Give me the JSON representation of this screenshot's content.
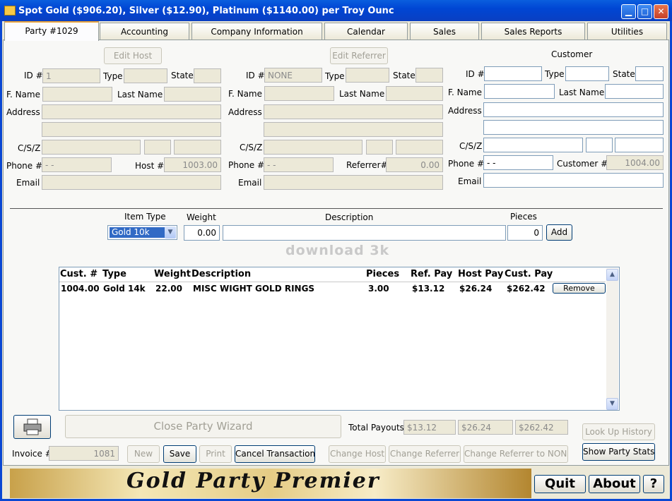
{
  "window": {
    "title": "Spot Gold ($906.20), Silver ($12.90), Platinum ($1140.00) per Troy Ounc"
  },
  "tabs": [
    "Party #1029",
    "Accounting",
    "Company Information",
    "Calendar",
    "Sales",
    "Sales Reports",
    "Utilities"
  ],
  "host": {
    "edit_button": "Edit Host",
    "id_label": "ID #",
    "id_value": "1",
    "type_label": "Type",
    "type_value": "",
    "state_label": "State",
    "state_value": "",
    "fname_label": "F. Name",
    "lname_label": "Last Name",
    "address_label": "Address",
    "csz_label": "C/S/Z",
    "phone_label": "Phone #",
    "phone_value": "-  -",
    "hostno_label": "Host #",
    "hostno_value": "1003.00",
    "email_label": "Email"
  },
  "referrer": {
    "edit_button": "Edit Referrer",
    "id_label": "ID #",
    "id_value": "NONE",
    "type_label": "Type",
    "state_label": "State",
    "fname_label": "F. Name",
    "lname_label": "Last Name",
    "address_label": "Address",
    "csz_label": "C/S/Z",
    "phone_label": "Phone #",
    "phone_value": "-  -",
    "refno_label": "Referrer#",
    "refno_value": "0.00",
    "email_label": "Email"
  },
  "customer": {
    "heading": "Customer",
    "id_label": "ID #",
    "type_label": "Type",
    "state_label": "State",
    "fname_label": "F. Name",
    "lname_label": "Last Name",
    "address_label": "Address",
    "csz_label": "C/S/Z",
    "phone_label": "Phone #",
    "phone_value": "-  -",
    "custno_label": "Customer #",
    "custno_value": "1004.00",
    "email_label": "Email"
  },
  "entry": {
    "item_type_label": "Item Type",
    "item_type_value": "Gold 10k",
    "weight_label": "Weight",
    "weight_value": "0.00",
    "description_label": "Description",
    "description_value": "",
    "pieces_label": "Pieces",
    "pieces_value": "0",
    "add_button": "Add"
  },
  "watermark": "download 3k",
  "grid": {
    "headers": [
      "Cust. #",
      "Type",
      "Weight",
      "Description",
      "Pieces",
      "Ref. Pay",
      "Host Pay",
      "Cust. Pay"
    ],
    "rows": [
      {
        "cust": "1004.00",
        "type": "Gold 14k",
        "weight": "22.00",
        "description": "MISC WIGHT GOLD RINGS",
        "pieces": "3.00",
        "ref_pay": "$13.12",
        "host_pay": "$26.24",
        "cust_pay": "$262.42",
        "action": "Remove"
      }
    ]
  },
  "wizard_button": "Close Party Wizard",
  "totals": {
    "label": "Total Payouts",
    "ref": "$13.12",
    "host": "$26.24",
    "cust": "$262.42"
  },
  "invoice": {
    "label": "Invoice #",
    "value": "1081"
  },
  "actions": {
    "new": "New",
    "save": "Save",
    "print": "Print",
    "cancel": "Cancel Transaction",
    "change_host": "Change Host",
    "change_referrer": "Change Referrer",
    "change_referrer_none": "Change Referrer to NONE",
    "lookup": "Look Up History",
    "stats": "Show Party Stats"
  },
  "banner_text": "Gold Party Premier",
  "bottom": {
    "quit": "Quit",
    "about": "About",
    "help": "?"
  }
}
